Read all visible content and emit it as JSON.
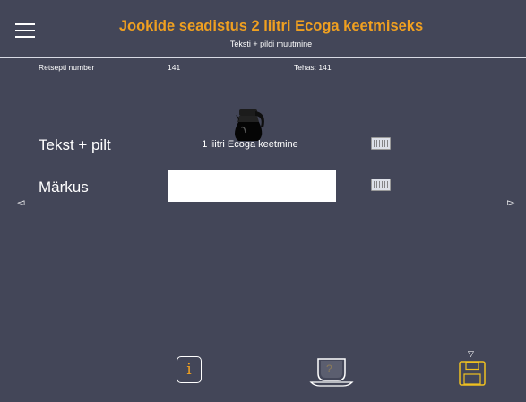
{
  "header": {
    "title": "Jookide seadistus 2 liitri Ecoga keetmiseks",
    "subtitle": "Teksti + pildi muutmine"
  },
  "info_row": {
    "recipe_label": "Retsepti number",
    "recipe_value": "141",
    "factory_text": "Tehas: 141"
  },
  "fields": {
    "text_image_label": "Tekst + pilt",
    "text_image_value": "1 liitri Ecoga keetmine",
    "note_label": "Märkus",
    "note_value": ""
  },
  "nav": {
    "prev": "◅",
    "next": "▻",
    "save_marker": "▽",
    "info_glyph": "i",
    "help_glyph": "?"
  },
  "colors": {
    "accent": "#f0a020",
    "background": "#434658"
  },
  "icons": [
    "menu-icon",
    "coffee-pot-icon",
    "keyboard-icon",
    "info-icon",
    "cup-help-icon",
    "save-icon"
  ]
}
